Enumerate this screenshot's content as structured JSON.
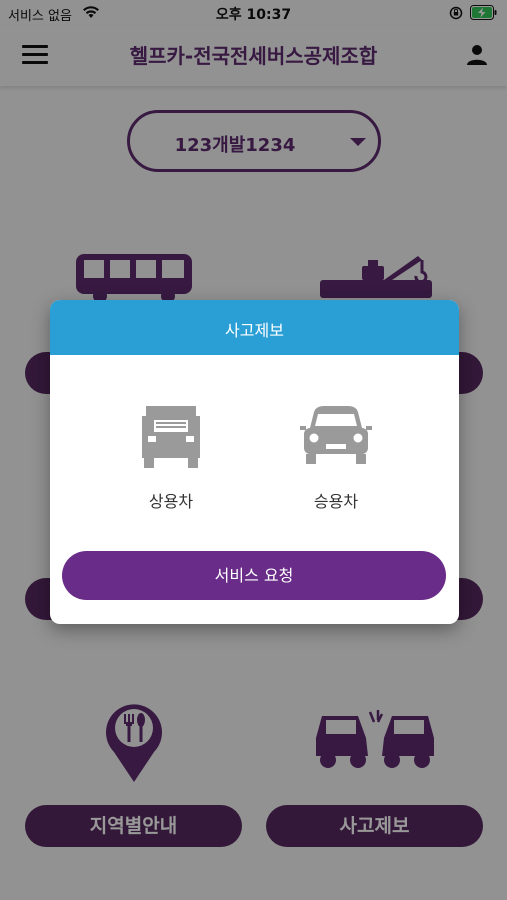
{
  "status_bar": {
    "carrier": "서비스 없음",
    "time": "오후 10:37"
  },
  "app_bar": {
    "title": "헬프카-전국전세버스공제조합"
  },
  "vehicle_select": {
    "value": "123개발1234"
  },
  "menu": {
    "regional_guide_label": "지역별안내",
    "accident_report_label": "사고제보"
  },
  "modal": {
    "title": "사고제보",
    "commercial_label": "상용차",
    "passenger_label": "승용차",
    "request_button_label": "서비스 요청"
  },
  "colors": {
    "brand_purple": "#5c2b6d",
    "modal_header": "#2a9fd6",
    "request_button": "#6a2c89"
  }
}
